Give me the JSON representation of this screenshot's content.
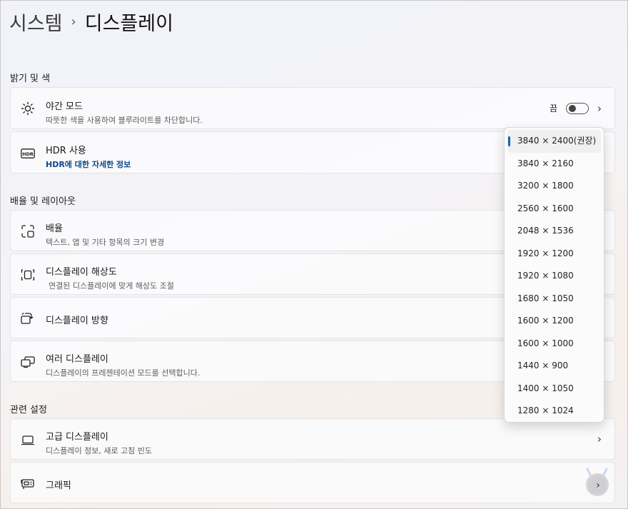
{
  "breadcrumb": {
    "parent": "시스템",
    "separator": "›",
    "current": "디스플레이"
  },
  "sections": {
    "brightness": "밝기 및 색",
    "scale_layout": "배율 및 레이아웃",
    "related": "관련 설정"
  },
  "night_light": {
    "label": "야간 모드",
    "desc": "따뜻한 색을 사용하여 블루라이트를 차단합니다.",
    "state_label": "끔",
    "toggle_on": false
  },
  "hdr": {
    "label": "HDR 사용",
    "link": "HDR에 대한 자세한 정보"
  },
  "scale": {
    "label": "배율",
    "desc": "텍스트, 앱 및 기타 항목의 크기 변경"
  },
  "resolution": {
    "label": "디스플레이 해상도",
    "desc": "연결된 디스플레이에 맞게 해상도 조절"
  },
  "orientation": {
    "label": "디스플레이 방향"
  },
  "multi": {
    "label": "여러 디스플레이",
    "desc": "디스플레이의 프레젠테이션 모드를 선택합니다."
  },
  "advanced": {
    "label": "고급 디스플레이",
    "desc": "디스플레이 정보, 새로 고침 빈도"
  },
  "graphics": {
    "label": "그래픽"
  },
  "resolution_options": [
    "3840 × 2400(권장)",
    "3840 × 2160",
    "3200 × 1800",
    "2560 × 1600",
    "2048 × 1536",
    "1920 × 1200",
    "1920 × 1080",
    "1680 × 1050",
    "1600 × 1200",
    "1600 × 1000",
    "1440 × 900",
    "1400 × 1050",
    "1280 × 1024"
  ],
  "selected_resolution_index": 0,
  "colors": {
    "accent": "#1c5fb2",
    "link": "#0f4a8a"
  }
}
